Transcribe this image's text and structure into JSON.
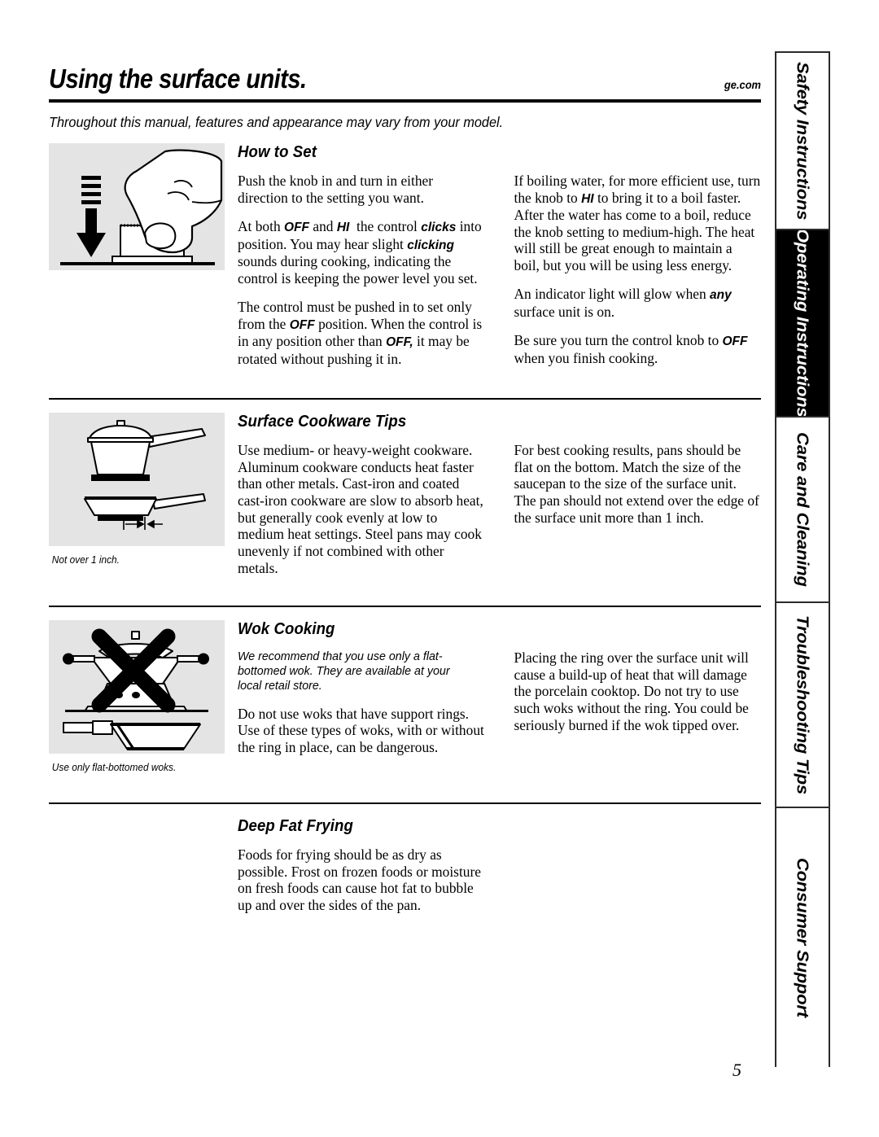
{
  "header": {
    "title": "Using the surface units.",
    "site_url": "ge.com",
    "subtitle": "Throughout this manual, features and appearance may vary from your model."
  },
  "sections": [
    {
      "id": "how-to-set",
      "heading": "How to Set",
      "figure_name": "hand-pushing-knob-illustration",
      "figure_caption": "",
      "left_column": [
        "Push the knob in and turn in either direction to the setting you want.",
        "At both OFF and HI the control clicks into position. You may hear slight clicking sounds during cooking, indicating the control is keeping the power level you set.",
        "The control must be pushed in to set only from the OFF position. When the control is in any position other than OFF, it may be rotated without pushing it in."
      ],
      "right_column": [
        "If boiling water, for more efficient use, turn the knob to HI to bring it to a boil faster. After the water has come to a boil, reduce the knob setting to medium-high. The heat will still be great enough to maintain a boil, but you will be using less energy.",
        "An indicator light will glow when any surface unit is on.",
        "Be sure you turn the control knob to OFF when you finish cooking."
      ]
    },
    {
      "id": "surface-cookware-tips",
      "heading": "Surface Cookware Tips",
      "figure_name": "saucepan-and-frypan-illustration",
      "figure_caption": "Not over 1 inch.",
      "left_column": [
        "Use medium- or heavy-weight cookware. Aluminum cookware conducts heat faster than other metals. Cast-iron and coated cast-iron cookware are slow to absorb heat, but generally cook evenly at low to medium heat settings. Steel pans may cook unevenly if not combined with other metals."
      ],
      "right_column": [
        "For best cooking results, pans should be flat on the bottom. Match the size of the saucepan to the size of the surface unit. The pan should not extend over the edge of the surface unit more than 1 inch."
      ]
    },
    {
      "id": "wok-cooking",
      "heading": "Wok Cooking",
      "figure_name": "wok-with-support-ring-crossed-out-illustration",
      "figure_caption": "Use only flat-bottomed woks.",
      "left_column_note": "We recommend that you use only a flat-bottomed wok. They are available at your local retail store.",
      "left_column": [
        "Do not use woks that have support rings. Use of these types of woks, with or without the ring in place, can be dangerous."
      ],
      "right_column": [
        "Placing the ring over the surface unit will cause a build-up of heat that will damage the porcelain cooktop. Do not try to use such woks without the ring. You could be seriously burned if the wok tipped over."
      ]
    },
    {
      "id": "deep-fat-frying",
      "heading": "Deep Fat Frying",
      "figure_name": "",
      "figure_caption": "",
      "left_column": [
        "Foods for frying should be as dry as possible. Frost on frozen foods or moisture on fresh foods can cause hot fat to bubble up and over the sides of the pan."
      ],
      "right_column": []
    }
  ],
  "tabs": [
    {
      "label": "Safety Instructions",
      "active": false
    },
    {
      "label": "Operating Instructions",
      "active": true
    },
    {
      "label": "Care and Cleaning",
      "active": false
    },
    {
      "label": "Troubleshooting Tips",
      "active": false
    },
    {
      "label": "Consumer Support",
      "active": false
    }
  ],
  "page_number": "5",
  "colors": {
    "text": "#000000",
    "figure_background": "#e4e4e4",
    "tab_border": "#2b2b2b",
    "active_tab_background": "#000000"
  }
}
